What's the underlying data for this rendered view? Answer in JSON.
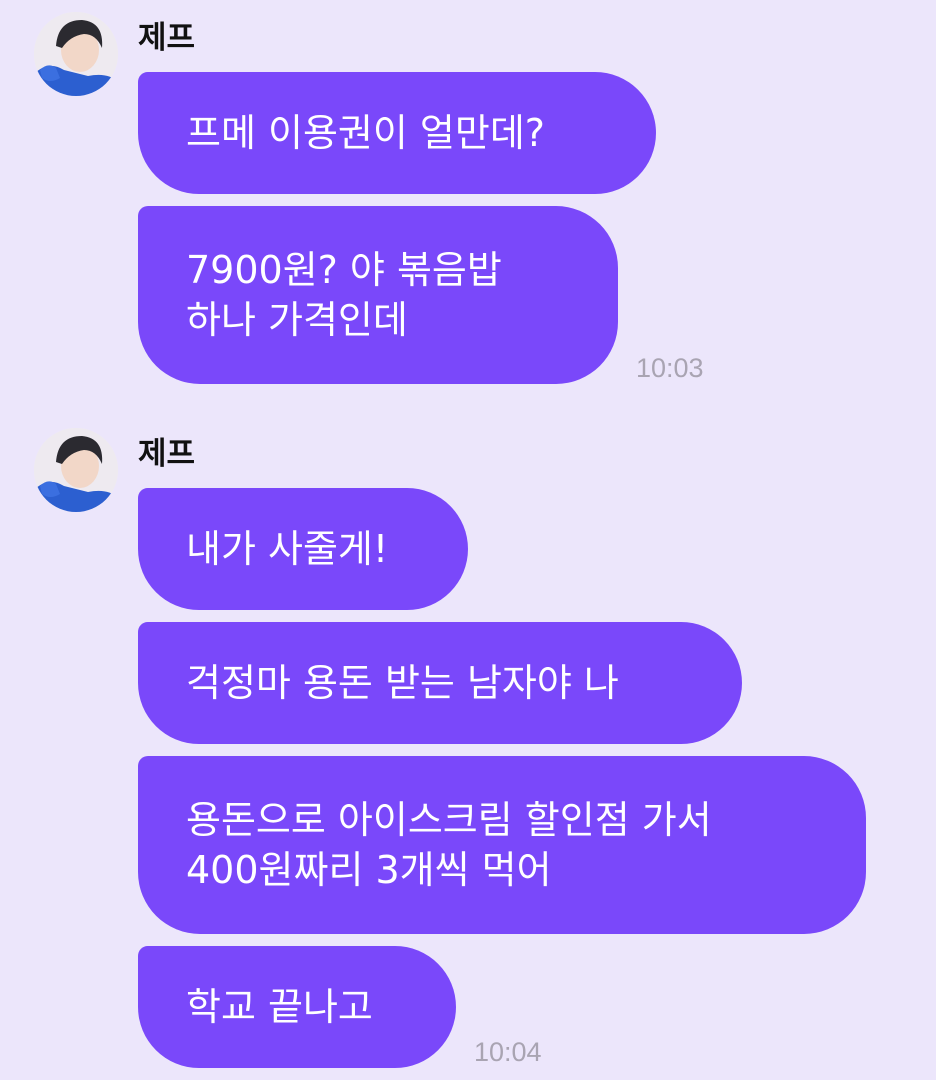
{
  "groups": [
    {
      "sender": "제프",
      "time": "10:03",
      "messages": [
        {
          "lines": [
            "프메 이용권이 얼만데?"
          ]
        },
        {
          "lines": [
            "7900원? 야 볶음밥",
            "하나 가격인데"
          ]
        }
      ]
    },
    {
      "sender": "제프",
      "time": "10:04",
      "messages": [
        {
          "lines": [
            "내가 사줄게!"
          ]
        },
        {
          "lines": [
            "걱정마 용돈 받는 남자야 나"
          ]
        },
        {
          "lines": [
            "용돈으로 아이스크림 할인점 가서",
            "400원짜리 3개씩 먹어"
          ]
        },
        {
          "lines": [
            "학교 끝나고"
          ]
        }
      ]
    }
  ],
  "colors": {
    "background": "#ECE6FB",
    "bubble": "#7A48FA",
    "bubble_text": "#FFFFFF",
    "timestamp": "#A9A4B2"
  }
}
